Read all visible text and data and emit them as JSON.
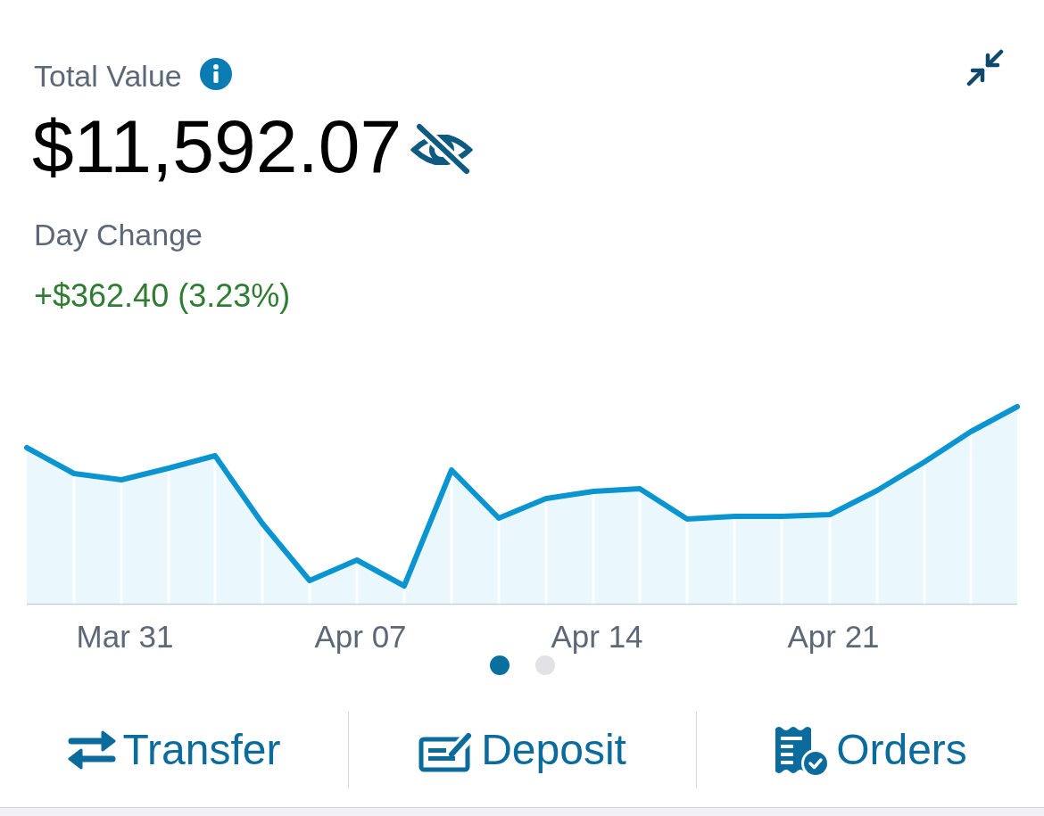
{
  "header": {
    "label": "Total Value"
  },
  "total_value": "$11,592.07",
  "day_change": {
    "label": "Day Change",
    "value": "+$362.40 (3.23%)"
  },
  "chart": {
    "x_labels": [
      "Mar 31",
      "Apr 07",
      "Apr 14",
      "Apr 21"
    ]
  },
  "pager": [
    {
      "selected": true
    },
    {
      "selected": false
    }
  ],
  "actions": [
    {
      "kind": "transfer",
      "label": "Transfer"
    },
    {
      "kind": "deposit",
      "label": "Deposit"
    },
    {
      "kind": "orders",
      "label": "Orders"
    }
  ]
}
